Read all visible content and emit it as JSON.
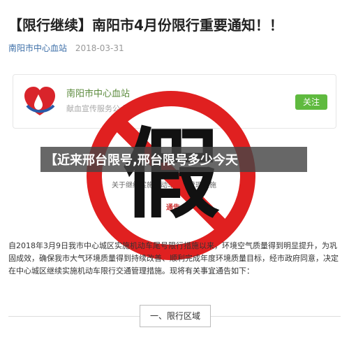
{
  "article": {
    "title": "【限行继续】南阳市4月份限行重要通知！！",
    "source": "南阳市中心血站",
    "date": "2018-03-31"
  },
  "account_card": {
    "name": "南阳市中心血站",
    "description": "献血宣传服务公众号",
    "follow_label": "关注"
  },
  "embedded_image": {
    "center_text": "关于继续实施机动车限行管理措施",
    "sub_text": "通告"
  },
  "overlay": {
    "stamp_text": "假",
    "banner_text": "【近来邢台限号,邢台限号多少今天"
  },
  "body": {
    "paragraph": "自2018年3月9日我市中心城区实施机动车尾号限行措施以来，环境空气质量得到明显提升，为巩固成效，确保我市大气环境质量得到持续改善、顺利完成年度环境质量目标，经市政府同意，决定在中心城区继续实施机动车限行交通管理措施。现将有关事宜通告如下："
  },
  "section": {
    "heading": "一、限行区域"
  },
  "colors": {
    "stamp_red": "#e02020",
    "stamp_black": "#111111",
    "follow_green": "#5fba3f"
  }
}
